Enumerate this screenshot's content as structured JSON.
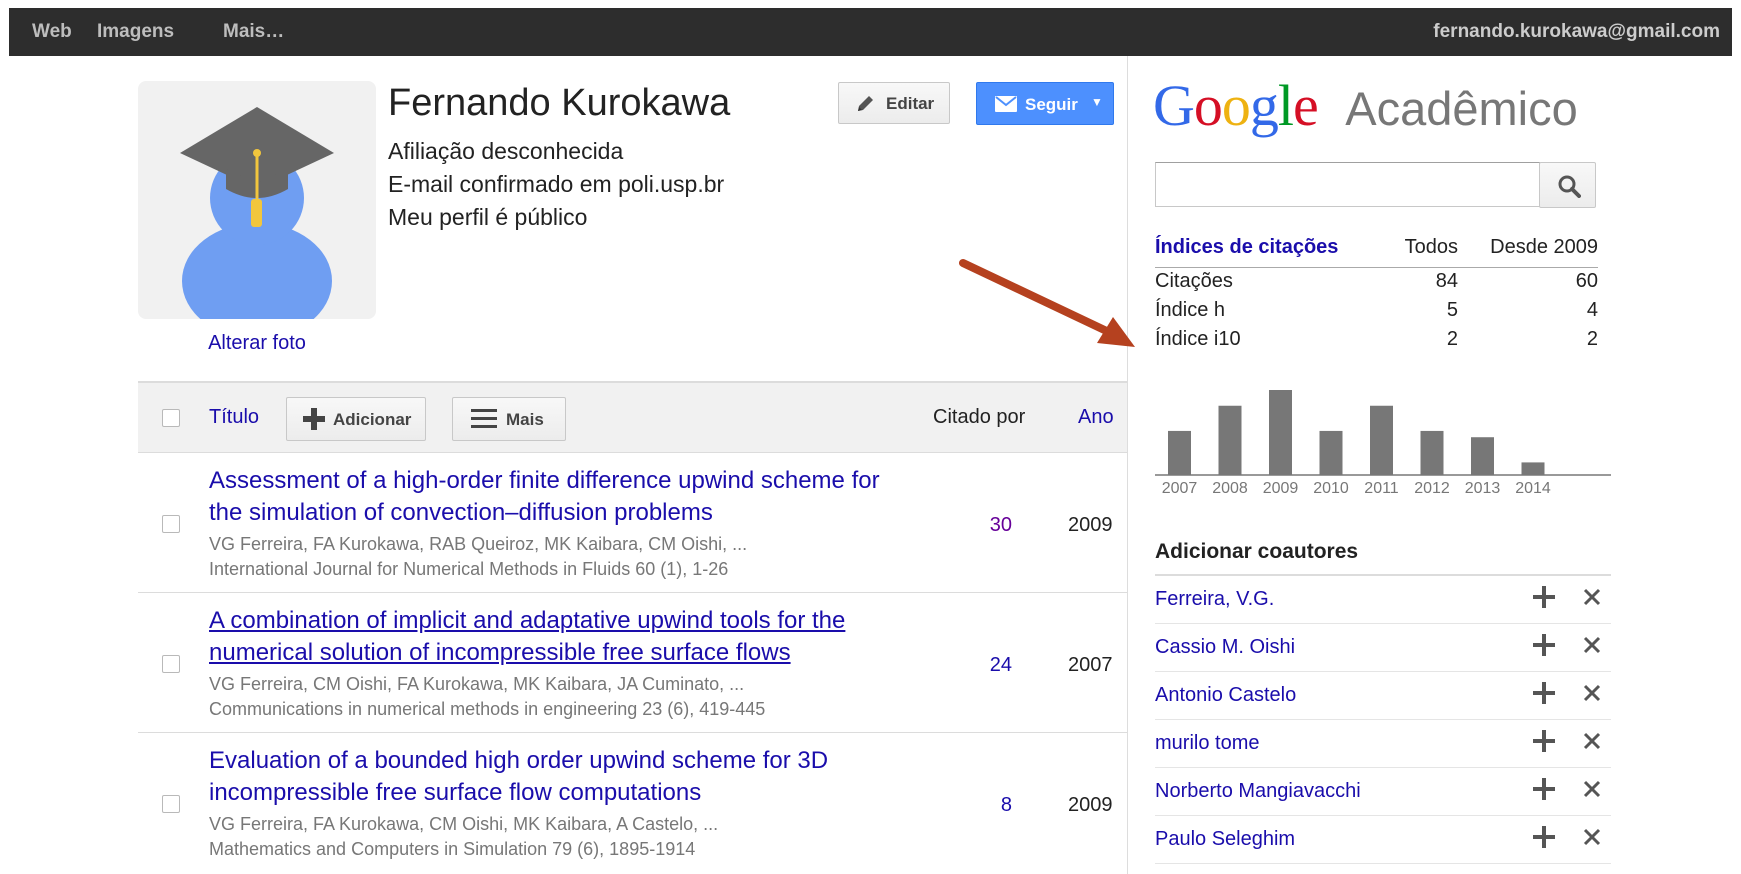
{
  "topbar": {
    "links": [
      "Web",
      "Imagens",
      "Mais…"
    ],
    "account_email": "fernando.kurokawa@gmail.com"
  },
  "profile": {
    "name": "Fernando Kurokawa",
    "affiliation": "Afiliação desconhecida",
    "email_verified": "E-mail confirmado em poli.usp.br",
    "visibility": "Meu perfil é público",
    "change_photo": "Alterar foto",
    "edit_label": "Editar",
    "follow_label": "Seguir"
  },
  "table": {
    "title_header": "Título",
    "add_label": "Adicionar",
    "more_label": "Mais",
    "cited_by_header": "Citado por",
    "year_header": "Ano"
  },
  "articles": [
    {
      "title": "Assessment of a high-order finite difference upwind scheme for the simulation of convection–diffusion problems",
      "authors": "VG Ferreira, FA Kurokawa, RAB Queiroz, MK Kaibara, CM Oishi, ...",
      "venue": "International Journal for Numerical Methods in Fluids 60 (1), 1-26",
      "cited_by": "30",
      "year": "2009"
    },
    {
      "title": "A combination of implicit and adaptative upwind tools for the numerical solution of incompressible free surface flows",
      "authors": "VG Ferreira, CM Oishi, FA Kurokawa, MK Kaibara, JA Cuminato, ...",
      "venue": "Communications in numerical methods in engineering 23 (6), 419-445",
      "cited_by": "24",
      "year": "2007"
    },
    {
      "title": "Evaluation of a bounded high order upwind scheme for 3D incompressible free surface flow computations",
      "authors": "VG Ferreira, FA Kurokawa, CM Oishi, MK Kaibara, A Castelo, ...",
      "venue": "Mathematics and Computers in Simulation 79 (6), 1895-1914",
      "cited_by": "8",
      "year": "2009"
    }
  ],
  "scholar": {
    "logo_google": "Google",
    "logo_academic": "Acadêmico",
    "search_value": ""
  },
  "citations": {
    "header": [
      "Índices de citações",
      "Todos",
      "Desde 2009"
    ],
    "rows": [
      [
        "Citações",
        "84",
        "60"
      ],
      [
        "Índice h",
        "5",
        "4"
      ],
      [
        "Índice i10",
        "2",
        "2"
      ]
    ]
  },
  "chart_data": {
    "type": "bar",
    "categories": [
      "2007",
      "2008",
      "2009",
      "2010",
      "2011",
      "2012",
      "2013",
      "2014"
    ],
    "values": [
      7,
      11,
      13.5,
      7,
      11,
      7,
      6,
      2
    ],
    "bar_color": "#777777"
  },
  "coauthors": {
    "title": "Adicionar coautores",
    "names": [
      "Ferreira, V.G.",
      "Cassio M. Oishi",
      "Antonio Castelo",
      "murilo tome",
      "Norberto Mangiavacchi",
      "Paulo Seleghim"
    ]
  },
  "colors": {
    "link": "#1a0dab",
    "follow_button": "#4d90fe",
    "topbar": "#2d2d2d",
    "annotation_arrow": "#b5411f"
  }
}
